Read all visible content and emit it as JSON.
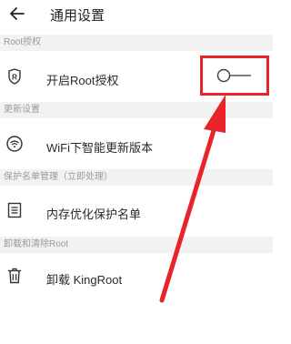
{
  "header": {
    "title": "通用设置"
  },
  "sections": [
    {
      "header": "Root授权",
      "item": {
        "label": "开启Root授权"
      }
    },
    {
      "header": "更新设置",
      "item": {
        "label": "WiFi下智能更新版本"
      }
    },
    {
      "header": "保护名单管理（立即处理）",
      "item": {
        "label": "内存优化保护名单"
      }
    },
    {
      "header": "卸载和清除Root",
      "item": {
        "label": "卸载 KingRoot"
      }
    }
  ],
  "toggle": {
    "state": "off"
  },
  "colors": {
    "highlight": "#e8232a",
    "section_bg": "#f2f2f2",
    "icon": "#333333"
  },
  "icons": {
    "back": "back-arrow-icon",
    "root": "root-r-icon",
    "wifi": "wifi-icon",
    "list": "list-icon",
    "uninstall": "trash-icon"
  }
}
